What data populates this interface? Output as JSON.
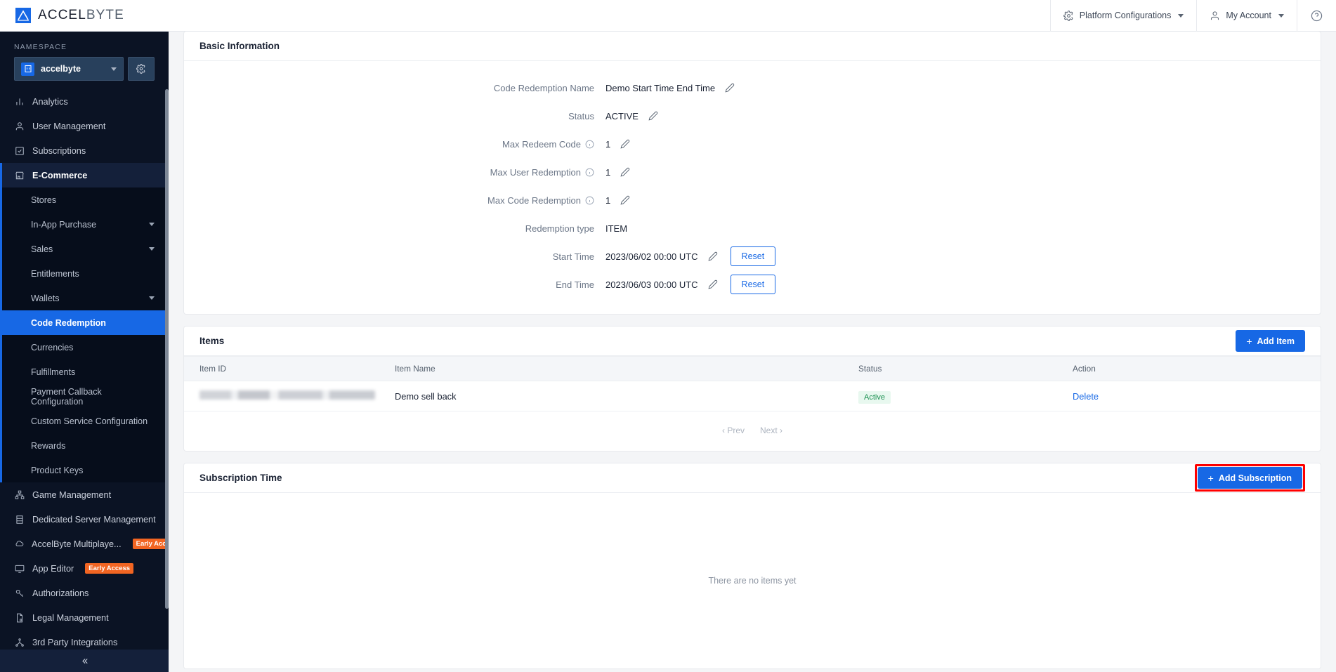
{
  "topbar": {
    "brand_primary": "ACCEL",
    "brand_secondary": "BYTE",
    "platform_configurations": "Platform Configurations",
    "my_account": "My Account"
  },
  "sidebar": {
    "namespace_label": "NAMESPACE",
    "namespace_value": "accelbyte",
    "items": [
      {
        "label": "Analytics",
        "icon": "bar-chart-icon",
        "type": "top"
      },
      {
        "label": "User Management",
        "icon": "user-icon",
        "type": "top"
      },
      {
        "label": "Subscriptions",
        "icon": "check-square-icon",
        "type": "top"
      },
      {
        "label": "E-Commerce",
        "icon": "store-icon",
        "type": "top",
        "state": "open"
      }
    ],
    "ecommerce_children": [
      {
        "label": "Stores",
        "expandable": false
      },
      {
        "label": "In-App Purchase",
        "expandable": true
      },
      {
        "label": "Sales",
        "expandable": true
      },
      {
        "label": "Entitlements",
        "expandable": false
      },
      {
        "label": "Wallets",
        "expandable": true
      },
      {
        "label": "Code Redemption",
        "expandable": false,
        "state": "active"
      },
      {
        "label": "Currencies",
        "expandable": false
      },
      {
        "label": "Fulfillments",
        "expandable": false
      },
      {
        "label": "Payment Callback Configuration",
        "expandable": false
      },
      {
        "label": "Custom Service Configuration",
        "expandable": false
      },
      {
        "label": "Rewards",
        "expandable": false
      },
      {
        "label": "Product Keys",
        "expandable": false
      }
    ],
    "bottom_items": [
      {
        "label": "Game Management",
        "icon": "sitemap-icon",
        "badge": ""
      },
      {
        "label": "Dedicated Server Management",
        "icon": "server-icon",
        "badge": ""
      },
      {
        "label": "AccelByte Multiplaye...",
        "icon": "cloud-icon",
        "badge": "Early Access"
      },
      {
        "label": "App Editor",
        "icon": "monitor-icon",
        "badge": "Early Access"
      },
      {
        "label": "Authorizations",
        "icon": "key-icon",
        "badge": ""
      },
      {
        "label": "Legal Management",
        "icon": "document-icon",
        "badge": ""
      },
      {
        "label": "3rd Party Integrations",
        "icon": "share-icon",
        "badge": ""
      }
    ],
    "collapse_icon": "chevron-double-left-icon"
  },
  "basic_information": {
    "title": "Basic Information",
    "rows": [
      {
        "label": "Code Redemption Name",
        "value": "Demo Start Time End Time",
        "has_info": false,
        "editable": true,
        "reset": false
      },
      {
        "label": "Status",
        "value": "ACTIVE",
        "has_info": false,
        "editable": true,
        "reset": false
      },
      {
        "label": "Max Redeem Code",
        "value": "1",
        "has_info": true,
        "editable": true,
        "reset": false
      },
      {
        "label": "Max User Redemption",
        "value": "1",
        "has_info": true,
        "editable": true,
        "reset": false
      },
      {
        "label": "Max Code Redemption",
        "value": "1",
        "has_info": true,
        "editable": true,
        "reset": false
      },
      {
        "label": "Redemption type",
        "value": "ITEM",
        "has_info": false,
        "editable": false,
        "reset": false
      },
      {
        "label": "Start Time",
        "value": "2023/06/02 00:00 UTC",
        "has_info": false,
        "editable": true,
        "reset": true
      },
      {
        "label": "End Time",
        "value": "2023/06/03 00:00 UTC",
        "has_info": false,
        "editable": true,
        "reset": true
      }
    ],
    "reset_label": "Reset"
  },
  "items_section": {
    "title": "Items",
    "add_button": "Add Item",
    "columns": [
      "Item ID",
      "Item Name",
      "Status",
      "Action"
    ],
    "rows": [
      {
        "item_id": "",
        "item_name": "Demo sell back",
        "status": "Active",
        "action": "Delete"
      }
    ],
    "pagination": {
      "prev": "Prev",
      "next": "Next"
    }
  },
  "subscription_section": {
    "title": "Subscription Time",
    "add_button": "Add Subscription",
    "empty_text": "There are no items yet",
    "highlight_color": "#ff0000"
  },
  "colors": {
    "accent": "#1768e5",
    "sidebar_bg": "#0b1324",
    "sidebar_sub_bg": "#060d1b",
    "badge_orange": "#f26522",
    "status_green": "#1f9254"
  }
}
